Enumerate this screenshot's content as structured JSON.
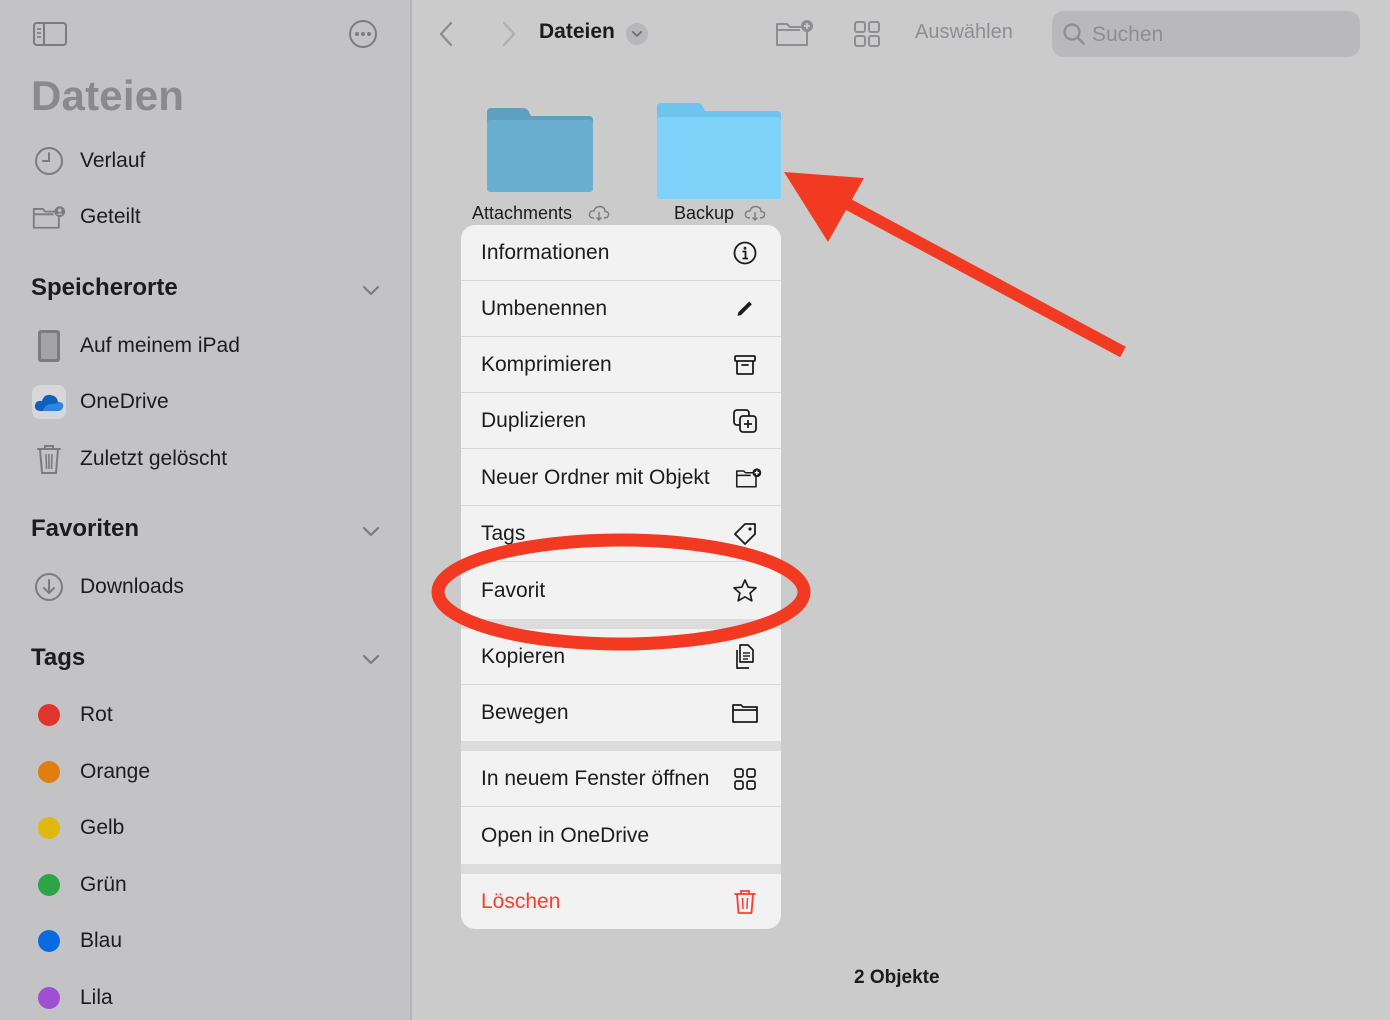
{
  "sidebar": {
    "title": "Dateien",
    "top_items": [
      {
        "label": "Verlauf",
        "icon": "clock-icon"
      },
      {
        "label": "Geteilt",
        "icon": "shared-folder-icon"
      }
    ],
    "sections": {
      "locations": {
        "title": "Speicherorte",
        "items": [
          {
            "label": "Auf meinem iPad",
            "icon": "ipad-icon"
          },
          {
            "label": "OneDrive",
            "icon": "onedrive-icon"
          },
          {
            "label": "Zuletzt gelöscht",
            "icon": "trash-icon"
          }
        ]
      },
      "favorites": {
        "title": "Favoriten",
        "items": [
          {
            "label": "Downloads",
            "icon": "download-icon"
          }
        ]
      },
      "tags": {
        "title": "Tags",
        "items": [
          {
            "label": "Rot",
            "color": "#e0342d"
          },
          {
            "label": "Orange",
            "color": "#e07f10"
          },
          {
            "label": "Gelb",
            "color": "#e0b80e"
          },
          {
            "label": "Grün",
            "color": "#2ea448"
          },
          {
            "label": "Blau",
            "color": "#0a6be0"
          },
          {
            "label": "Lila",
            "color": "#a04ed2"
          }
        ]
      }
    }
  },
  "toolbar": {
    "title": "Dateien",
    "select_label": "Auswählen",
    "search_placeholder": "Suchen"
  },
  "folders": [
    {
      "name": "Attachments",
      "color": "#6aaed0"
    },
    {
      "name": "Backup",
      "color": "#7fd2fa"
    }
  ],
  "context_menu": {
    "items": [
      {
        "label": "Informationen",
        "icon": "info-icon"
      },
      {
        "label": "Umbenennen",
        "icon": "pencil-icon"
      },
      {
        "label": "Komprimieren",
        "icon": "archive-icon"
      },
      {
        "label": "Duplizieren",
        "icon": "duplicate-icon"
      },
      {
        "label": "Neuer Ordner mit Objekt",
        "icon": "new-folder-icon"
      },
      {
        "label": "Tags",
        "icon": "tag-icon"
      },
      {
        "label": "Favorit",
        "icon": "star-icon"
      },
      {
        "label": "Kopieren",
        "icon": "copy-icon"
      },
      {
        "label": "Bewegen",
        "icon": "folder-icon"
      },
      {
        "label": "In neuem Fenster öffnen",
        "icon": "grid-icon"
      },
      {
        "label": "Open in OneDrive",
        "icon": ""
      },
      {
        "label": "Löschen",
        "icon": "trash-icon"
      }
    ]
  },
  "status": "2 Objekte",
  "annotation": {
    "color": "#f23a22"
  }
}
